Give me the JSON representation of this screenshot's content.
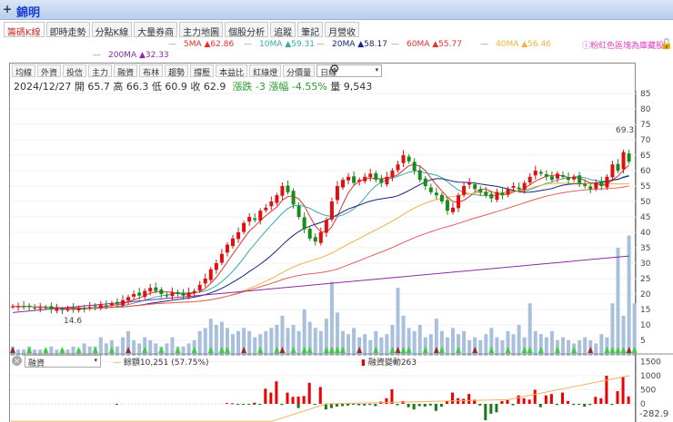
{
  "title": {
    "name": "錦明",
    "add": "+"
  },
  "tabs": [
    "籌碼K線",
    "即時走勢",
    "分點K線",
    "大量券商",
    "主力地圖",
    "個股分析",
    "追蹤",
    "筆記",
    "月營收"
  ],
  "legend": [
    {
      "label": "5MA ▲62.86",
      "color": "#e03030"
    },
    {
      "label": "10MA ▲59.31",
      "color": "#3aa8a8"
    },
    {
      "label": "20MA ▲58.17",
      "color": "#1a237e"
    },
    {
      "label": "60MA ▲55.77",
      "color": "#e03030"
    },
    {
      "label": "40MA ▲56.46",
      "color": "#f0b040"
    },
    {
      "label": "200MA ▲32.33",
      "color": "#8a2aa0"
    }
  ],
  "hint": "ⓘ粉紅色區塊為庫藏股",
  "toolbar": [
    "均線",
    "外資",
    "投信",
    "主力",
    "融資",
    "布林",
    "趨勢",
    "撐壓",
    "本益比",
    "紅綠燈",
    "分價量"
  ],
  "period_select": "日線",
  "info": {
    "date": "2024/12/27",
    "open": "開 65.7",
    "high": "高 66.3",
    "low": "低 60.9",
    "close": "收 62.9",
    "change": "漲跌 -3",
    "pct": "漲幅 -4.55%",
    "volume": "量 9,543"
  },
  "price_axis": [
    85,
    80,
    75,
    70,
    65,
    60,
    55,
    50,
    45,
    40,
    35,
    30,
    25,
    20,
    15,
    10,
    5
  ],
  "max_label": "69.3",
  "min_label": "14.6",
  "chart_data": {
    "type": "candlestick",
    "closes": [
      16,
      16,
      15.8,
      16,
      15.5,
      15.5,
      15.6,
      15,
      15.2,
      14.8,
      15,
      15.2,
      15.5,
      15.3,
      15.8,
      16,
      16.5,
      16.3,
      17,
      16.8,
      18,
      19,
      20,
      19.5,
      21,
      22,
      21,
      20,
      19.5,
      20.5,
      20,
      19.5,
      20.5,
      21,
      23,
      25,
      28,
      30,
      33,
      36,
      38,
      40,
      43,
      45,
      44,
      47,
      48,
      50,
      52,
      55,
      53,
      49,
      45,
      41,
      38,
      37,
      40,
      44,
      50,
      55,
      57,
      58,
      56,
      57,
      58,
      59,
      57,
      56,
      58,
      60,
      62,
      65,
      63,
      60,
      57,
      55,
      53,
      52,
      50,
      47,
      48,
      52,
      55,
      56,
      54,
      53,
      52,
      51,
      53,
      52,
      54,
      55,
      54,
      56,
      58,
      60,
      59,
      58,
      57,
      59,
      58,
      57,
      58,
      56,
      55,
      54,
      56,
      55,
      58,
      62,
      60,
      66,
      62.9
    ],
    "volumes": [
      3,
      2,
      2,
      3,
      2,
      2,
      2,
      3,
      2,
      2,
      2,
      3,
      2,
      4,
      3,
      3,
      6,
      4,
      5,
      3,
      6,
      8,
      5,
      4,
      6,
      5,
      4,
      3,
      4,
      6,
      3,
      3,
      4,
      5,
      8,
      9,
      12,
      10,
      11,
      9,
      7,
      8,
      9,
      8,
      6,
      7,
      8,
      9,
      10,
      13,
      9,
      10,
      8,
      15,
      11,
      9,
      8,
      12,
      24,
      14,
      8,
      7,
      9,
      6,
      7,
      5,
      8,
      6,
      7,
      10,
      22,
      13,
      9,
      8,
      10,
      6,
      7,
      12,
      8,
      6,
      9,
      7,
      8,
      5,
      6,
      5,
      7,
      9,
      6,
      5,
      8,
      7,
      10,
      6,
      17,
      8,
      7,
      6,
      8,
      5,
      6,
      5,
      4,
      5,
      6,
      5,
      4,
      7,
      6,
      17,
      35,
      13,
      39,
      17
    ],
    "ma200": [
      14,
      32.33
    ],
    "margin_label": "融資",
    "margin_balance": "餘額10,251 (57.75%)",
    "margin_change_label": "融資變動263",
    "margin_axis": [
      1500,
      1000,
      500,
      0
    ],
    "margin_last": "-282.9",
    "margin_changes": [
      0,
      0,
      0,
      0,
      0,
      0,
      0,
      0,
      0,
      0,
      0,
      0,
      0,
      0,
      0,
      0,
      0,
      0,
      0,
      0,
      0,
      -20,
      0,
      0,
      0,
      0,
      0,
      0,
      0,
      0,
      0,
      0,
      0,
      0,
      0,
      0,
      0,
      0,
      0,
      0,
      0,
      0,
      0,
      0,
      30,
      20,
      -10,
      -15,
      -20,
      40,
      -30,
      -10,
      540,
      400,
      800,
      -40,
      400,
      250,
      -150,
      260,
      280,
      750,
      -20,
      600,
      -200,
      -150,
      -100,
      -80,
      -40,
      -60,
      -30,
      -50,
      -60,
      -40,
      -80,
      80,
      60,
      200,
      520,
      -50,
      100,
      -120,
      -200,
      -80,
      -100,
      -30,
      -60,
      -250,
      -100,
      100,
      400,
      200,
      180,
      350,
      150,
      100,
      -60,
      -580,
      -350,
      -300,
      100,
      150,
      -50,
      200,
      300,
      200,
      150,
      500,
      -120,
      300,
      350,
      -40,
      400,
      200,
      100,
      -40,
      -20,
      -100,
      -40,
      250,
      200,
      280,
      1000,
      -40,
      450,
      950,
      263
    ],
    "margin_balance_line": [
      -300,
      -300,
      1000
    ]
  }
}
